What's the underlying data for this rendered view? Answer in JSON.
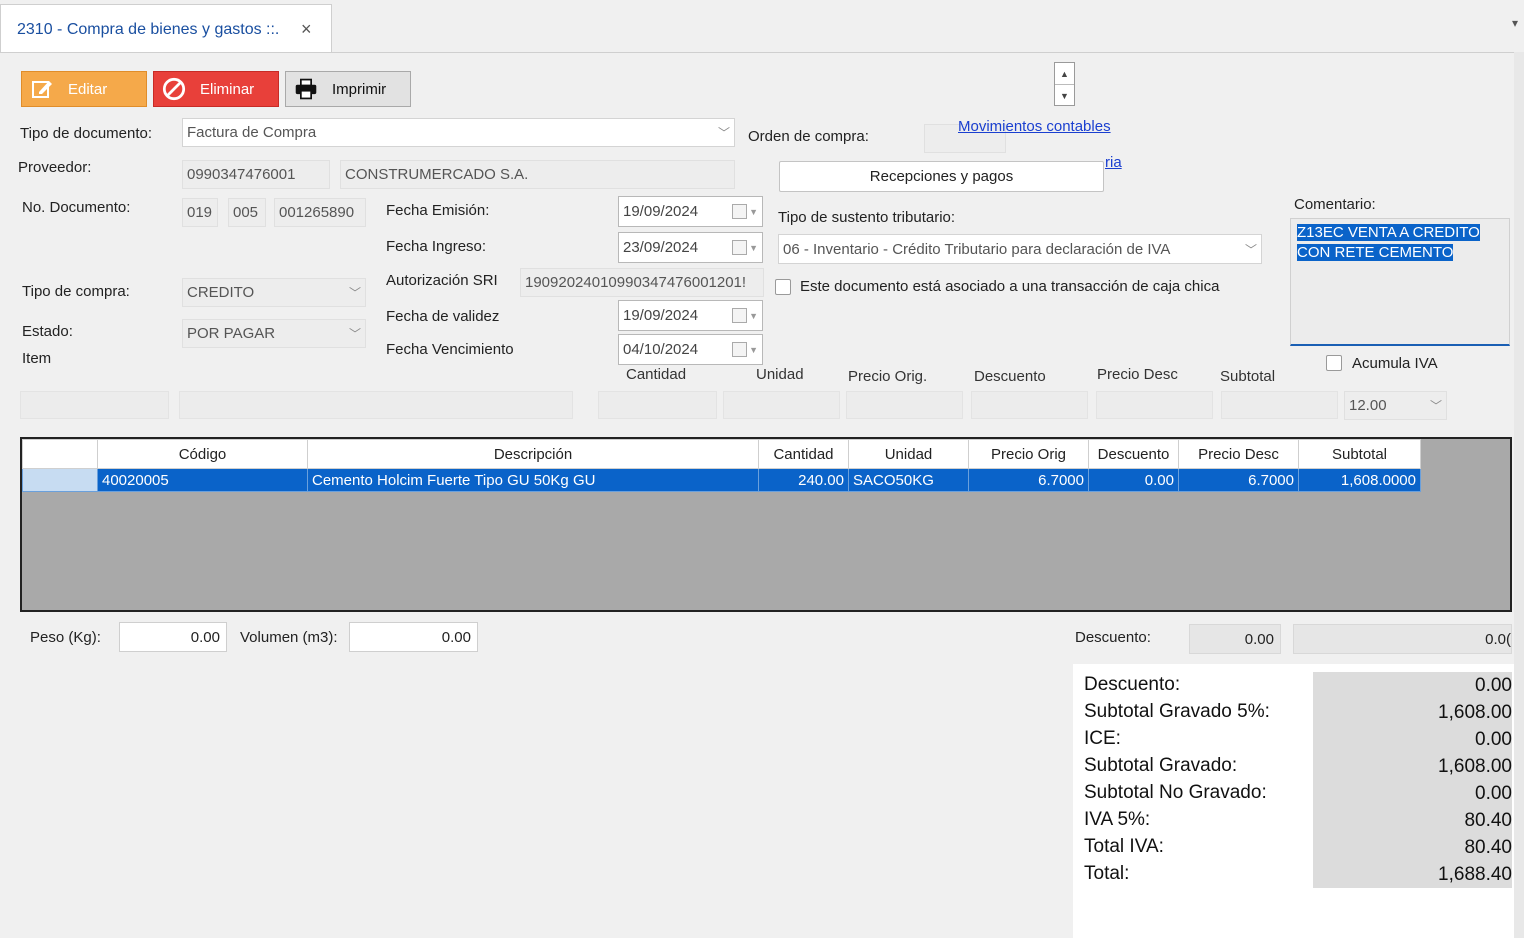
{
  "tab": {
    "title": "2310 - Compra de bienes y gastos ::.",
    "close": "×"
  },
  "toolbar": {
    "edit": "Editar",
    "delete": "Eliminar",
    "print": "Imprimir"
  },
  "links": {
    "movimientos": "Movimientos contables",
    "auditoria": "ria"
  },
  "buttons": {
    "recepciones": "Recepciones y pagos"
  },
  "labels": {
    "tipo_documento": "Tipo de documento:",
    "proveedor": "Proveedor:",
    "no_documento": "No. Documento:",
    "tipo_compra": "Tipo de compra:",
    "estado": "Estado:",
    "item": "Item",
    "fecha_emision": "Fecha Emisión:",
    "fecha_ingreso": "Fecha Ingreso:",
    "autorizacion": "Autorización SRI",
    "fecha_validez": "Fecha de validez",
    "fecha_vencimiento": "Fecha Vencimiento",
    "orden_compra": "Orden de compra:",
    "sustento": "Tipo de sustento tributario:",
    "caja_chica": "Este documento está asociado a una transacción de caja chica",
    "comentario": "Comentario:",
    "acumula_iva": "Acumula IVA",
    "peso": "Peso (Kg):",
    "volumen": "Volumen (m3):",
    "descuento": "Descuento:"
  },
  "fields": {
    "tipo_documento": "Factura de Compra",
    "proveedor_ruc": "0990347476001",
    "proveedor_nombre": "CONSTRUMERCADO S.A.",
    "doc_serie1": "019",
    "doc_serie2": "005",
    "doc_numero": "001265890",
    "tipo_compra": "CREDITO",
    "estado": "POR PAGAR",
    "fecha_emision": "19/09/2024",
    "fecha_ingreso": "23/09/2024",
    "autorizacion": "19092024010990347476001201!",
    "fecha_validez": "19/09/2024",
    "fecha_vencimiento": "04/10/2024",
    "sustento": "06 - Inventario - Crédito Tributario para declaración de IVA",
    "comentario_line1": "Z13EC VENTA A CREDITO ",
    "comentario_line2": "CON RETE CEMENTO",
    "iva_rate": "12.00",
    "peso": "0.00",
    "volumen": "0.00",
    "descuento": "0.00",
    "descuento_total": "0.0("
  },
  "item_headers": [
    "Cantidad",
    "Unidad",
    "Precio Orig.",
    "Descuento",
    "Precio Desc",
    "Subtotal"
  ],
  "grid": {
    "headers": [
      "Código",
      "Descripción",
      "Cantidad",
      "Unidad",
      "Precio Orig",
      "Descuento",
      "Precio Desc",
      "Subtotal"
    ],
    "rows": [
      [
        "40020005",
        "Cemento Holcim Fuerte Tipo GU 50Kg  GU",
        "240.00",
        "SACO50KG",
        "6.7000",
        "0.00",
        "6.7000",
        "1,608.0000"
      ]
    ]
  },
  "totals": [
    {
      "label": "Descuento:",
      "value": "0.00"
    },
    {
      "label": "Subtotal Gravado 5%:",
      "value": "1,608.00"
    },
    {
      "label": "ICE:",
      "value": "0.00"
    },
    {
      "label": "Subtotal Gravado:",
      "value": "1,608.00"
    },
    {
      "label": "Subtotal No Gravado:",
      "value": "0.00"
    },
    {
      "label": "IVA 5%:",
      "value": "80.40"
    },
    {
      "label": "Total IVA:",
      "value": "80.40"
    },
    {
      "label": "Total:",
      "value": "1,688.40"
    }
  ]
}
